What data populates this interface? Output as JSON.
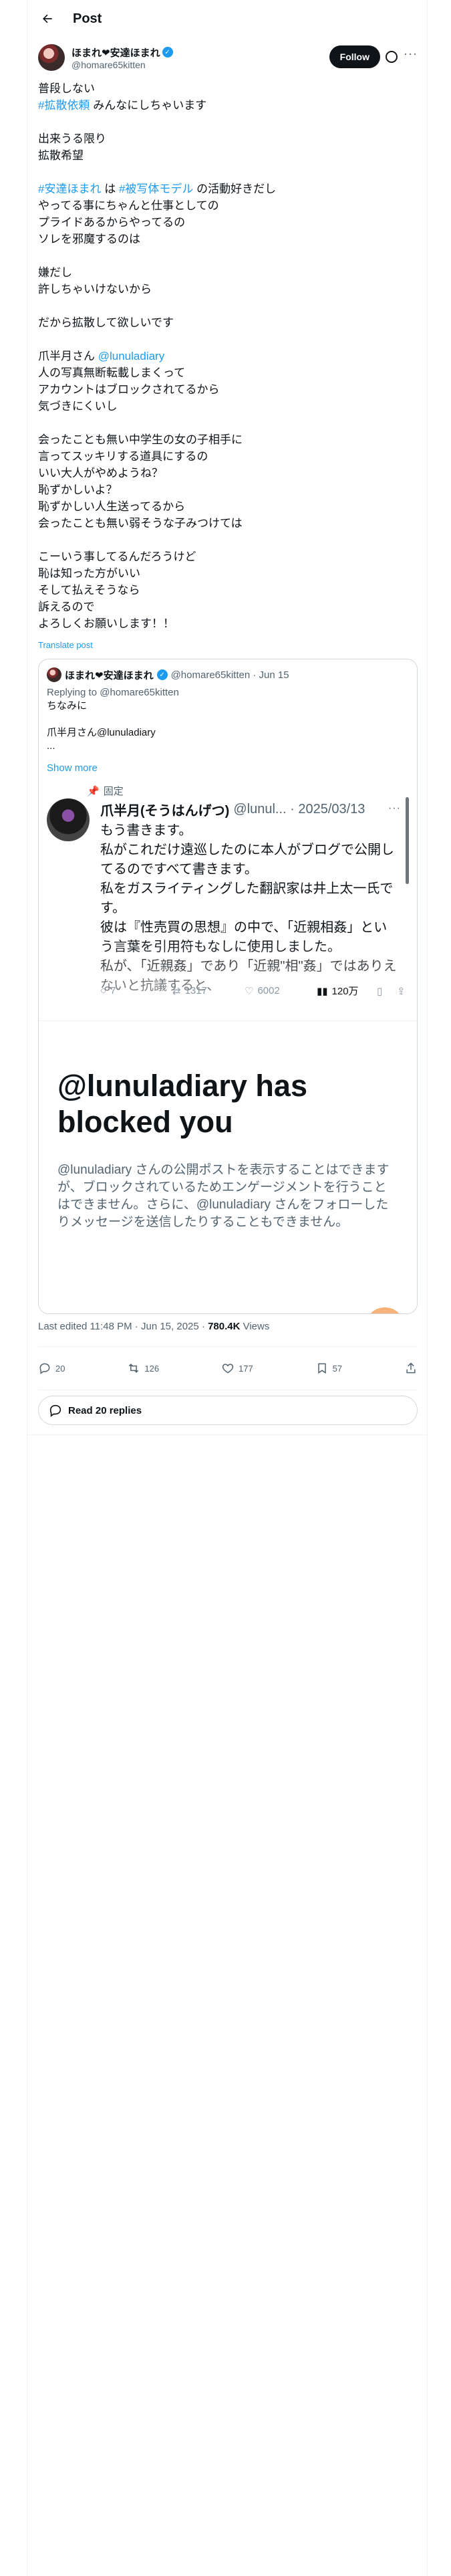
{
  "header": {
    "title": "Post"
  },
  "author": {
    "display_name": "ほまれ❤安達ほまれ",
    "handle": "@homare65kitten",
    "follow_label": "Follow"
  },
  "post": {
    "lines": [
      "普段しない",
      "#拡散依頼|みんなにしちゃいます",
      "",
      "出来うる限り",
      "拡散希望",
      "",
      "#安達ほまれ|は|#被写体モデル|の活動好きだし",
      "やってる事にちゃんと仕事としての",
      "プライドあるからやってるの",
      "ソレを邪魔するのは",
      "",
      "嫌だし",
      "許しちゃいけないから",
      "",
      "だから拡散して欲しいです",
      "",
      "爪半月さん|@lunuladiary",
      "人の写真無断転載しまくって",
      "アカウントはブロックされてるから",
      "気づきにくいし",
      "",
      "会ったことも無い中学生の女の子相手に",
      "言ってスッキリする道具にするの",
      "いい大人がやめようね？",
      "恥ずかしいよ？",
      "恥ずかしい人生送ってるから",
      "会ったことも無い弱そうな子みつけては",
      "",
      "こーいう事してるんだろうけど",
      "恥は知った方がいい",
      "そして払えそうなら",
      "訴えるので",
      "よろしくお願いします！！"
    ],
    "translate_label": "Translate post"
  },
  "quote": {
    "display_name": "ほまれ❤安達ほまれ",
    "meta": "@homare65kitten · Jun 15",
    "replying": "Replying to @homare65kitten",
    "line1": "ちなみに",
    "line2": "爪半月さん@lunuladiary",
    "ellipsis": "...",
    "show_more": "Show more",
    "embed": {
      "pinned_label": "固定",
      "name": "爪半月(そうはんげつ)",
      "meta": "@lunul... · 2025/03/13",
      "lines": [
        "もう書きます。",
        "私がこれだけ遠巡したのに本人がブログで公開し",
        "てるのですべて書きます。",
        "私をガスライティングした翻訳家は井上太一氏で",
        "す。",
        "彼は『性売買の思想』の中で、「近親相姦」とい",
        "う言葉を引用符もなしに使用しました。",
        "私が、「近親姦」であり「近親\"相\"姦」ではありえ",
        "ないと抗議すると、"
      ],
      "reply_count": "7",
      "repost_count": "1317",
      "like_count": "6002",
      "views": "120万"
    },
    "blocked_title": "@lunuladiary has blocked you",
    "blocked_text": "@lunuladiary さんの公開ポストを表示することはできますが、ブロックされているためエンゲージメントを行うことはできません。さらに、@lunuladiary さんをフォローしたりメッセージを送信したりすることもできません。"
  },
  "meta": {
    "edited": "Last edited 11:48 PM · Jun 15, 2025 · ",
    "views": "780.4K",
    "views_label": " Views"
  },
  "stats": {
    "replies": "20",
    "reposts": "126",
    "likes": "177",
    "bookmarks": "57"
  },
  "read_replies": "Read 20 replies",
  "colors": {
    "accent": "#1d9bf0",
    "text": "#0f1419",
    "muted": "#536471"
  }
}
